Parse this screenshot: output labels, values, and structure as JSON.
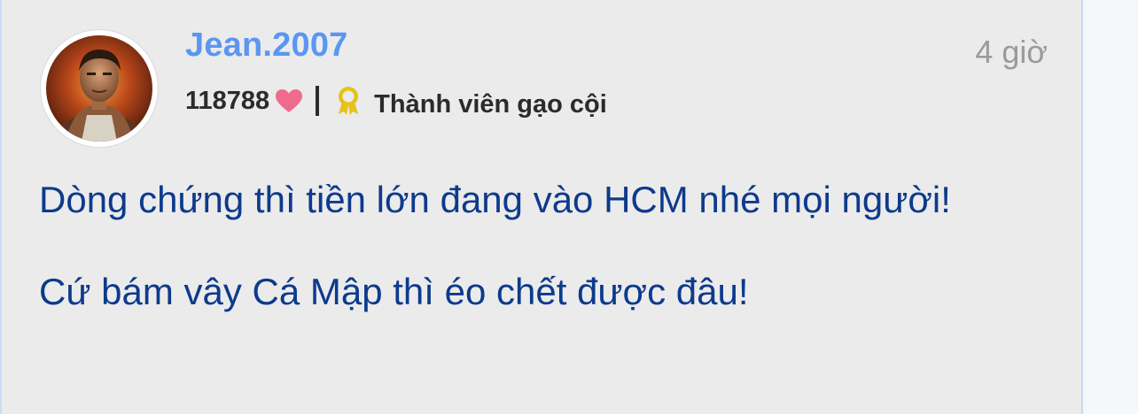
{
  "post": {
    "author": "Jean.2007",
    "time": "4 giờ",
    "likes": "118788",
    "rank": "Thành viên gạo cội",
    "body": [
      "Dòng chứng thì tiền lớn đang vào HCM nhé mọi người!",
      "Cứ bám vây Cá Mập thì éo chết được đâu!"
    ]
  },
  "icons": {
    "likes": "heart-icon",
    "rank": "award-ribbon-icon"
  },
  "colors": {
    "author": "#5b96f2",
    "body_text": "#0d3a8c",
    "heart": "#f06a8f",
    "badge": "#e6c21a",
    "card_bg": "#ebebeb",
    "card_border": "#c9daf4",
    "time": "#9a9a9a"
  }
}
